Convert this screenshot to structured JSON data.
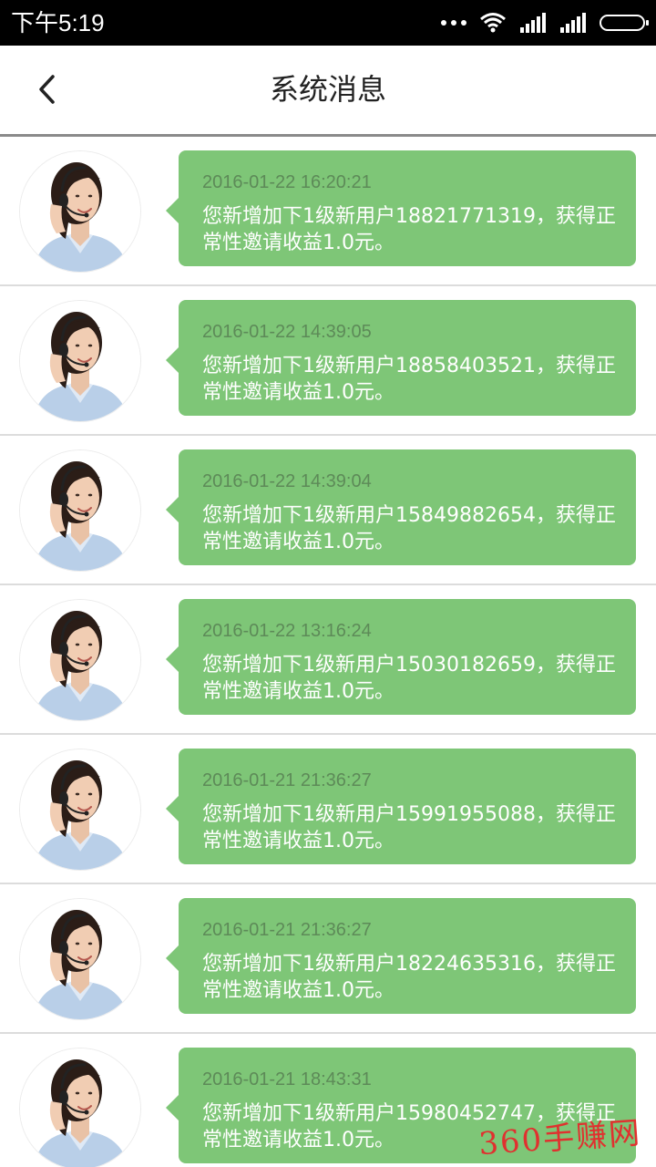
{
  "status_bar": {
    "time": "下午5:19",
    "icons": [
      "more-dots-icon",
      "wifi-icon",
      "signal-icon",
      "signal-icon",
      "battery-icon"
    ]
  },
  "header": {
    "back_icon": "chevron-left-icon",
    "title": "系统消息"
  },
  "messages": [
    {
      "timestamp": "2016-01-22 16:20:21",
      "text": "您新增加下1级新用户18821771319，获得正常性邀请收益1.0元。"
    },
    {
      "timestamp": "2016-01-22 14:39:05",
      "text": "您新增加下1级新用户18858403521，获得正常性邀请收益1.0元。"
    },
    {
      "timestamp": "2016-01-22 14:39:04",
      "text": "您新增加下1级新用户15849882654，获得正常性邀请收益1.0元。"
    },
    {
      "timestamp": "2016-01-22 13:16:24",
      "text": "您新增加下1级新用户15030182659，获得正常性邀请收益1.0元。"
    },
    {
      "timestamp": "2016-01-21 21:36:27",
      "text": "您新增加下1级新用户15991955088，获得正常性邀请收益1.0元。"
    },
    {
      "timestamp": "2016-01-21 21:36:27",
      "text": "您新增加下1级新用户18224635316，获得正常性邀请收益1.0元。"
    },
    {
      "timestamp": "2016-01-21 18:43:31",
      "text": "您新增加下1级新用户15980452747，获得正常性邀请收益1.0元。"
    }
  ],
  "watermark": "360手赚网",
  "colors": {
    "bubble": "#7ec677",
    "timestamp": "#5d8a58",
    "status_bar": "#000000",
    "watermark": "#e0312f"
  }
}
